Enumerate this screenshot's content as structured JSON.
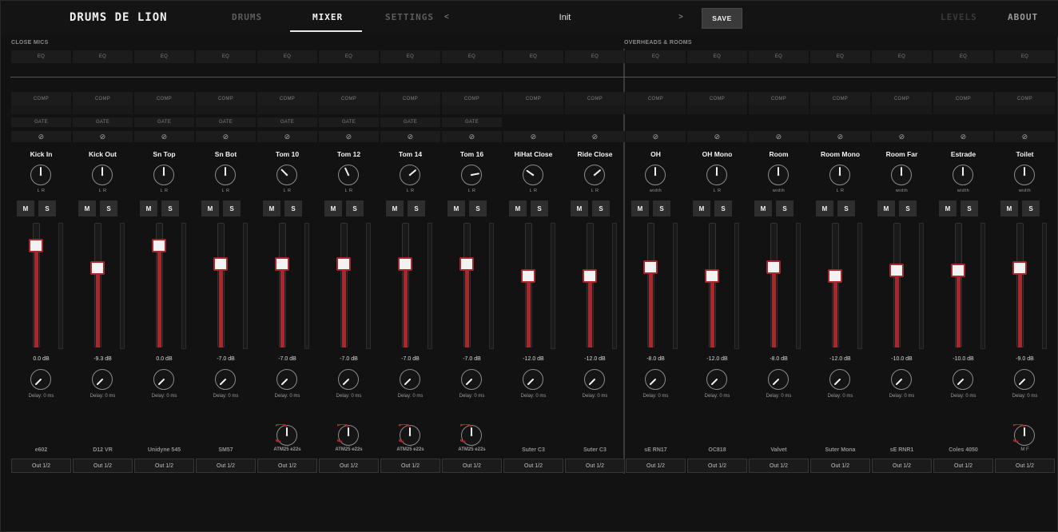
{
  "app": {
    "title": "DRUMS DE LION"
  },
  "nav": {
    "tabs": [
      "DRUMS",
      "MIXER",
      "SETTINGS"
    ],
    "active_tab": "MIXER",
    "prev_arrow": "<",
    "next_arrow": ">",
    "preset_name": "Init",
    "save_label": "SAVE",
    "levels_label": "LEVELS",
    "about_label": "ABOUT"
  },
  "groups": {
    "close_mics": "CLOSE MICS",
    "overheads_rooms": "OVERHEADS & ROOMS"
  },
  "labels": {
    "eq": "EQ",
    "comp": "COMP",
    "gate": "GATE",
    "phase_icon": "⊘"
  },
  "colors": {
    "accent": "#a8282d",
    "background": "#121212",
    "panel": "#1c1c1c"
  },
  "channels": [
    {
      "name": "Kick In",
      "pan_label": "L  R",
      "knob_angle": 0,
      "db": "0.0 dB",
      "level": 0.82,
      "delay": "Delay: 0 ms",
      "mic": "e602",
      "output": "Out 1/2",
      "gate": true
    },
    {
      "name": "Kick Out",
      "pan_label": "L  R",
      "knob_angle": 0,
      "db": "-9.3 dB",
      "level": 0.64,
      "delay": "Delay: 0 ms",
      "mic": "D12 VR",
      "output": "Out 1/2",
      "gate": true
    },
    {
      "name": "Sn Top",
      "pan_label": "L  R",
      "knob_angle": 0,
      "db": "0.0 dB",
      "level": 0.82,
      "delay": "Delay: 0 ms",
      "mic": "Unidyne 545",
      "output": "Out 1/2",
      "gate": true
    },
    {
      "name": "Sn Bot",
      "pan_label": "L  R",
      "knob_angle": 0,
      "db": "-7.0 dB",
      "level": 0.67,
      "delay": "Delay: 0 ms",
      "mic": "SM57",
      "output": "Out 1/2",
      "gate": true
    },
    {
      "name": "Tom 10",
      "pan_label": "L  R",
      "knob_angle": -45,
      "db": "-7.0 dB",
      "level": 0.67,
      "delay": "Delay: 0 ms",
      "mic": "ATM25  e22s",
      "output": "Out 1/2",
      "gate": true,
      "bleed": true
    },
    {
      "name": "Tom 12",
      "pan_label": "L  R",
      "knob_angle": -25,
      "db": "-7.0 dB",
      "level": 0.67,
      "delay": "Delay: 0 ms",
      "mic": "ATM25  e22s",
      "output": "Out 1/2",
      "gate": true,
      "bleed": true
    },
    {
      "name": "Tom 14",
      "pan_label": "L  R",
      "knob_angle": 50,
      "db": "-7.0 dB",
      "level": 0.67,
      "delay": "Delay: 0 ms",
      "mic": "ATM25  e22s",
      "output": "Out 1/2",
      "gate": true,
      "bleed": true
    },
    {
      "name": "Tom 16",
      "pan_label": "L  R",
      "knob_angle": 80,
      "db": "-7.0 dB",
      "level": 0.67,
      "delay": "Delay: 0 ms",
      "mic": "ATM25  e22s",
      "output": "Out 1/2",
      "gate": true,
      "bleed": true
    },
    {
      "name": "HiHat Close",
      "pan_label": "L  R",
      "knob_angle": -55,
      "db": "-12.0 dB",
      "level": 0.58,
      "delay": "Delay: 0 ms",
      "mic": "Suter C3",
      "output": "Out 1/2",
      "gate": false
    },
    {
      "name": "Ride Close",
      "pan_label": "L  R",
      "knob_angle": 50,
      "db": "-12.0 dB",
      "level": 0.58,
      "delay": "Delay: 0 ms",
      "mic": "Suter C3",
      "output": "Out 1/2",
      "gate": false
    },
    {
      "name": "OH",
      "pan_label": "width",
      "knob_angle": 0,
      "db": "-8.0 dB",
      "level": 0.65,
      "delay": "Delay: 0 ms",
      "mic": "sE RN17",
      "output": "Out 1/2",
      "gate": false
    },
    {
      "name": "OH Mono",
      "pan_label": "L  R",
      "knob_angle": 0,
      "db": "-12.0 dB",
      "level": 0.58,
      "delay": "Delay: 0 ms",
      "mic": "OC818",
      "output": "Out 1/2",
      "gate": false
    },
    {
      "name": "Room",
      "pan_label": "width",
      "knob_angle": 0,
      "db": "-8.0 dB",
      "level": 0.65,
      "delay": "Delay: 0 ms",
      "mic": "Valvet",
      "output": "Out 1/2",
      "gate": false
    },
    {
      "name": "Room Mono",
      "pan_label": "L  R",
      "knob_angle": 0,
      "db": "-12.0 dB",
      "level": 0.58,
      "delay": "Delay: 0 ms",
      "mic": "Suter Mona",
      "output": "Out 1/2",
      "gate": false
    },
    {
      "name": "Room Far",
      "pan_label": "width",
      "knob_angle": 0,
      "db": "-10.0 dB",
      "level": 0.62,
      "delay": "Delay: 0 ms",
      "mic": "sE RNR1",
      "output": "Out 1/2",
      "gate": false
    },
    {
      "name": "Estrade",
      "pan_label": "width",
      "knob_angle": 0,
      "db": "-10.0 dB",
      "level": 0.62,
      "delay": "Delay: 0 ms",
      "mic": "Coles 4050",
      "output": "Out 1/2",
      "gate": false
    },
    {
      "name": "Toilet",
      "pan_label": "width",
      "knob_angle": 0,
      "db": "-9.0 dB",
      "level": 0.64,
      "delay": "Delay: 0 ms",
      "mic": "",
      "output": "Out 1/2",
      "gate": false,
      "bleed": true,
      "extra_label": "M  F"
    }
  ]
}
